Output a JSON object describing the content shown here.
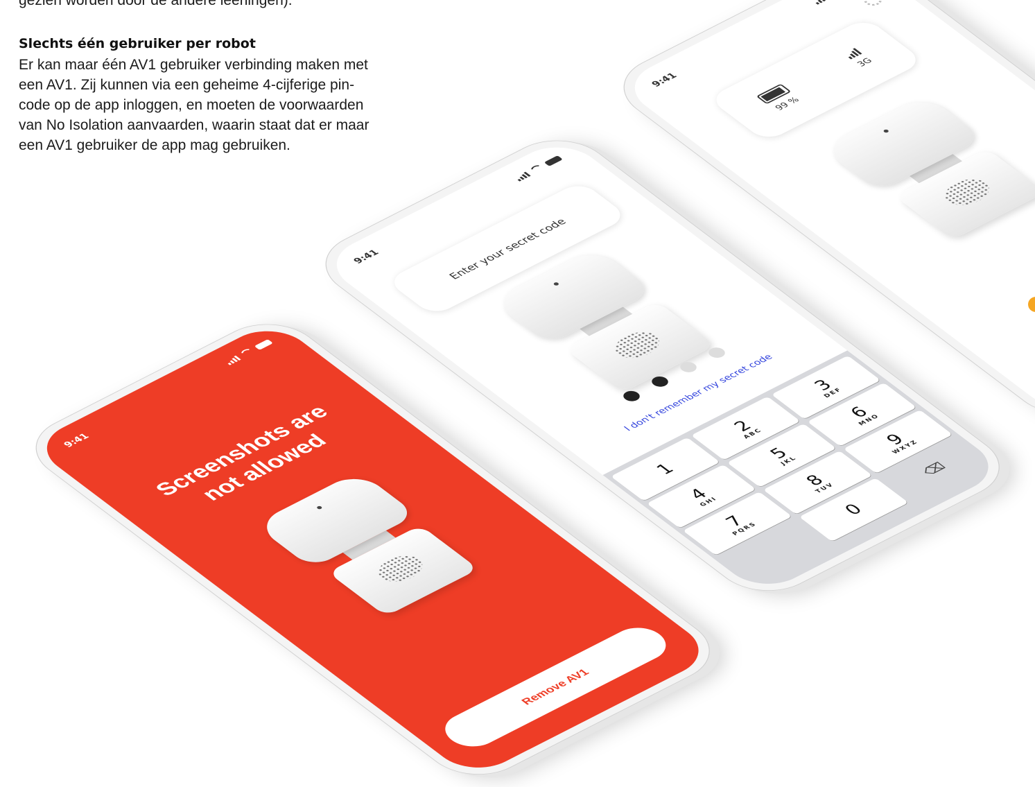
{
  "article": {
    "cut_line": "gezien worden door de andere leerlingen).",
    "heading": "Slechts één gebruiker per robot",
    "body": [
      "Er kan maar één AV1 gebruiker verbinding maken met",
      "een AV1. Zij kunnen via een geheime 4-cijferige pin-",
      "code op de app inloggen, en moeten de voorwaarden",
      "van No Isolation aanvaarden, waarin staat dat er maar",
      "een AV1 gebruiker de app mag gebruiken."
    ]
  },
  "phones": {
    "time": "9:41",
    "red": {
      "title_line1": "Screenshots are",
      "title_line2": "not allowed",
      "button": "Remove AV1",
      "color": "#ee3d26"
    },
    "code": {
      "prompt": "Enter your secret code",
      "filled": 2,
      "total": 4,
      "forgot": "I don't remember my secret code",
      "keys": [
        {
          "d": "1",
          "l": ""
        },
        {
          "d": "2",
          "l": "ABC"
        },
        {
          "d": "3",
          "l": "DEF"
        },
        {
          "d": "4",
          "l": "GHI"
        },
        {
          "d": "5",
          "l": "JKL"
        },
        {
          "d": "6",
          "l": "MNO"
        },
        {
          "d": "7",
          "l": "PQRS"
        },
        {
          "d": "8",
          "l": "TUV"
        },
        {
          "d": "9",
          "l": "WXYZ"
        }
      ],
      "zero": "0",
      "delete": "⌫"
    },
    "status": {
      "battery": "99 %",
      "network": "3G",
      "accent": "#f5a623"
    }
  }
}
